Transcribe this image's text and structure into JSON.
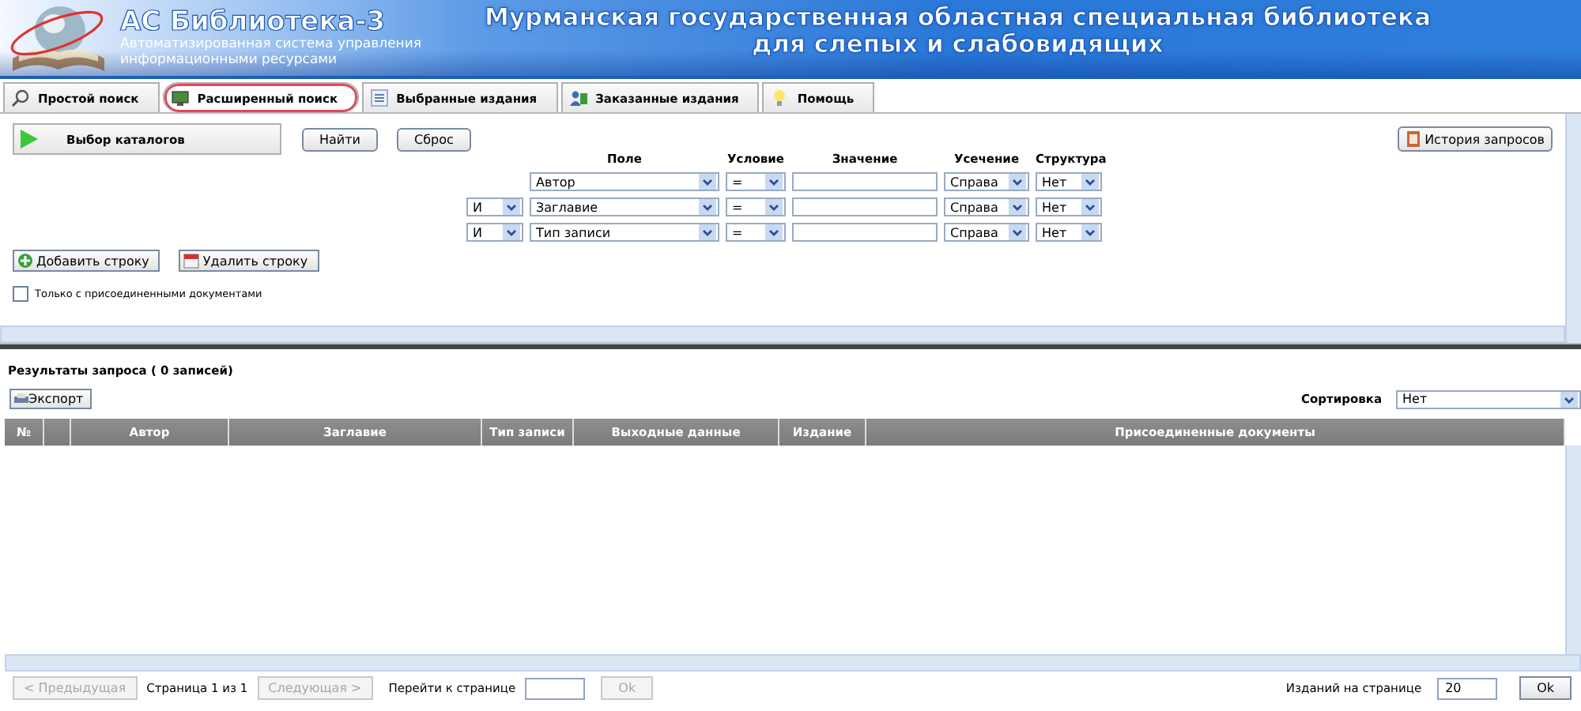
{
  "header": {
    "title": "АС Библиотека-3",
    "subtitle": [
      "Автоматизированная система управления",
      "информационными ресурсами"
    ],
    "library": [
      "Мурманская государственная областная специальная библиотека",
      "для слепых и слабовидящих"
    ]
  },
  "tabs": [
    {
      "label": "Простой поиск",
      "selected": false
    },
    {
      "label": "Расширенный поиск",
      "selected": true
    },
    {
      "label": "Выбранные издания",
      "selected": false
    },
    {
      "label": "Заказанные издания",
      "selected": false
    },
    {
      "label": "Помощь",
      "selected": false
    }
  ],
  "search": {
    "catalogs_button": "Выбор каталогов",
    "find_button": "Найти",
    "reset_button": "Сброс",
    "history_button": "История запросов",
    "columns": [
      "Поле",
      "Условие",
      "Значение",
      "Усечение",
      "Структура"
    ],
    "criteria": [
      {
        "field": "Автор",
        "condition": "=",
        "truncation": "Справа",
        "structure": "Нет"
      },
      {
        "connector": "И",
        "field": "Заглавие",
        "condition": "=",
        "truncation": "Справа",
        "structure": "Нет"
      },
      {
        "connector": "И",
        "field": "Тип записи",
        "condition": "=",
        "truncation": "Справа",
        "structure": "Нет"
      }
    ],
    "add_row_button": "Добавить строку",
    "delete_row_button": "Удалить строку",
    "attached_only": {
      "label": "Только с присоединенными документами",
      "checked": false
    }
  },
  "results": {
    "title": "Результаты запроса ( 0 записей)",
    "export_button": "Экспорт",
    "sort_label": "Сортировка",
    "sort_value": "Нет",
    "columns": [
      "№",
      "Автор",
      "Заглавие",
      "Тип записи",
      "Выходные данные",
      "Издание",
      "Присоединенные документы"
    ]
  },
  "pager": {
    "prev": {
      "label": "< Предыдущая",
      "disabled": true
    },
    "page_info": "Страница 1 из 1",
    "next": {
      "label": "Следующая >",
      "disabled": true
    },
    "goto_label": "Перейти к странице",
    "goto_ok": {
      "label": "Ok",
      "disabled": true
    },
    "per_page_label": "Изданий на странице",
    "per_page_value": "20",
    "per_page_ok": {
      "label": "Ok",
      "disabled": false
    }
  }
}
